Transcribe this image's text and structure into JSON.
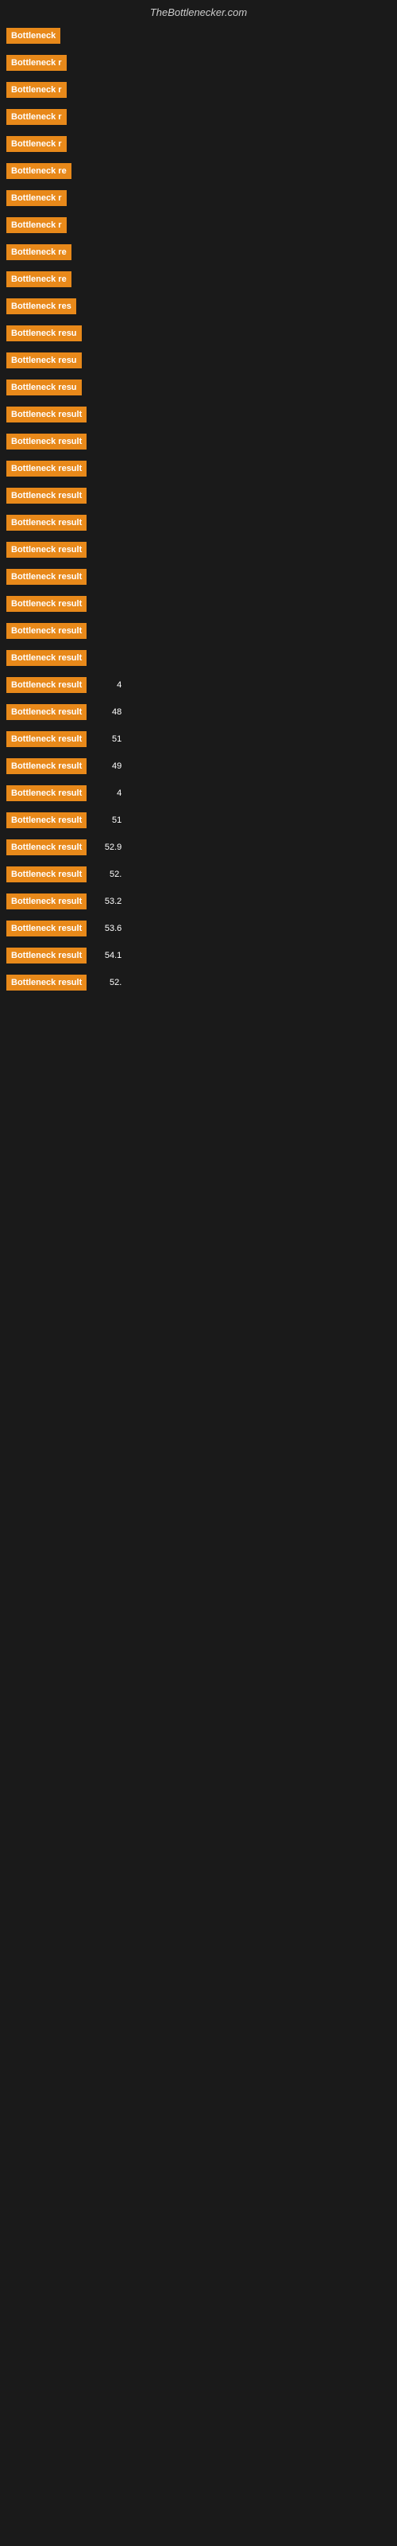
{
  "site_title": "TheBottlenecker.com",
  "rows": [
    {
      "label": "Bottleneck",
      "value": ""
    },
    {
      "label": "Bottleneck r",
      "value": ""
    },
    {
      "label": "Bottleneck r",
      "value": ""
    },
    {
      "label": "Bottleneck r",
      "value": ""
    },
    {
      "label": "Bottleneck r",
      "value": ""
    },
    {
      "label": "Bottleneck re",
      "value": ""
    },
    {
      "label": "Bottleneck r",
      "value": ""
    },
    {
      "label": "Bottleneck r",
      "value": ""
    },
    {
      "label": "Bottleneck re",
      "value": ""
    },
    {
      "label": "Bottleneck re",
      "value": ""
    },
    {
      "label": "Bottleneck res",
      "value": ""
    },
    {
      "label": "Bottleneck resu",
      "value": ""
    },
    {
      "label": "Bottleneck resu",
      "value": ""
    },
    {
      "label": "Bottleneck resu",
      "value": ""
    },
    {
      "label": "Bottleneck result",
      "value": ""
    },
    {
      "label": "Bottleneck result",
      "value": ""
    },
    {
      "label": "Bottleneck result",
      "value": ""
    },
    {
      "label": "Bottleneck result",
      "value": ""
    },
    {
      "label": "Bottleneck result",
      "value": ""
    },
    {
      "label": "Bottleneck result",
      "value": ""
    },
    {
      "label": "Bottleneck result",
      "value": ""
    },
    {
      "label": "Bottleneck result",
      "value": ""
    },
    {
      "label": "Bottleneck result",
      "value": ""
    },
    {
      "label": "Bottleneck result",
      "value": ""
    },
    {
      "label": "Bottleneck result",
      "value": "4"
    },
    {
      "label": "Bottleneck result",
      "value": "48"
    },
    {
      "label": "Bottleneck result",
      "value": "51"
    },
    {
      "label": "Bottleneck result",
      "value": "49"
    },
    {
      "label": "Bottleneck result",
      "value": "4"
    },
    {
      "label": "Bottleneck result",
      "value": "51"
    },
    {
      "label": "Bottleneck result",
      "value": "52.9"
    },
    {
      "label": "Bottleneck result",
      "value": "52."
    },
    {
      "label": "Bottleneck result",
      "value": "53.2"
    },
    {
      "label": "Bottleneck result",
      "value": "53.6"
    },
    {
      "label": "Bottleneck result",
      "value": "54.1"
    },
    {
      "label": "Bottleneck result",
      "value": "52."
    }
  ]
}
